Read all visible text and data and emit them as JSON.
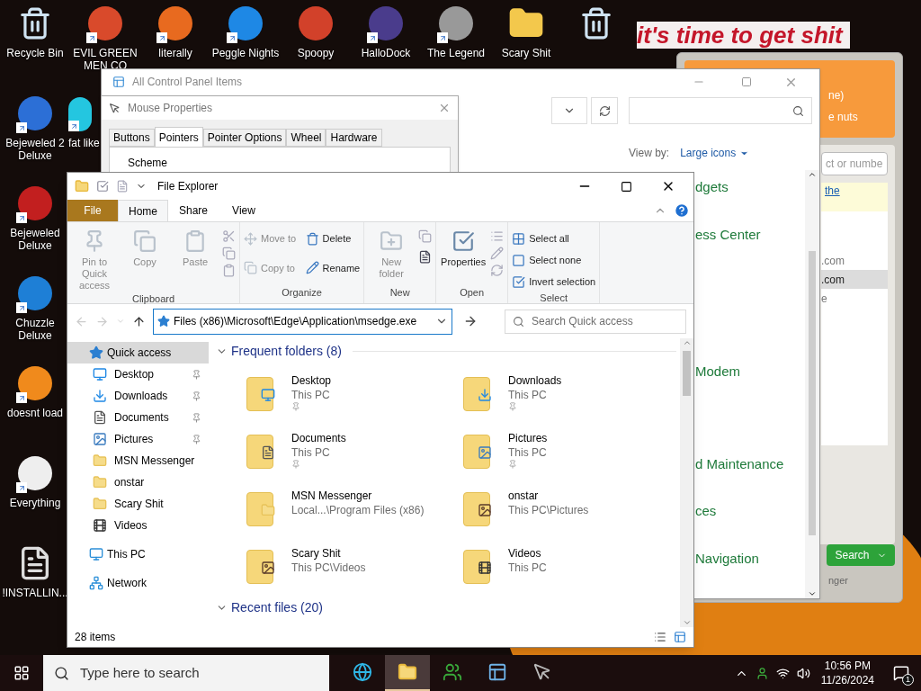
{
  "wallpaper": {
    "slogan": "it's time to get shit"
  },
  "desktop_top": [
    {
      "label": "Recycle Bin",
      "kind": "bin",
      "shortcut": false
    },
    {
      "label": "EVIL GREEN MEN CO",
      "kind": "app",
      "shortcut": true
    },
    {
      "label": "literally",
      "kind": "app",
      "shortcut": true
    },
    {
      "label": "Peggle Nights",
      "kind": "app",
      "shortcut": true
    },
    {
      "label": "Spoopy",
      "kind": "app",
      "shortcut": false
    },
    {
      "label": "HalloDock",
      "kind": "app",
      "shortcut": true
    },
    {
      "label": "The Legend",
      "kind": "app",
      "shortcut": true
    },
    {
      "label": "Scary Shit",
      "kind": "folder",
      "shortcut": false
    },
    {
      "kind": "bin",
      "shortcut": false
    }
  ],
  "desktop_left": [
    {
      "label": "Bejeweled 2 Deluxe",
      "kind": "app",
      "shortcut": true
    },
    {
      "label": "fat like",
      "kind": "app",
      "shortcut": true
    },
    {
      "label": "Bejeweled Deluxe",
      "kind": "app",
      "shortcut": true
    },
    {
      "label": "Chuzzle Deluxe",
      "kind": "app",
      "shortcut": true
    },
    {
      "label": "doesnt load",
      "kind": "app",
      "shortcut": true
    },
    {
      "label": "Everything",
      "kind": "app",
      "shortcut": true
    },
    {
      "label": "!INSTALLIN...",
      "kind": "document",
      "shortcut": false
    }
  ],
  "messenger": {
    "header_lines": [
      "ne)",
      "e nuts"
    ],
    "search_placeholder": "ct or numbe",
    "notice_link": "the",
    "contacts": [
      {
        "label": ".com",
        "selected": false
      },
      {
        "label": ".com",
        "selected": true
      },
      {
        "label": "e",
        "selected": false
      }
    ],
    "search_button": "Search",
    "footer": "nger"
  },
  "control_panel": {
    "title": "All Control Panel Items",
    "view_by_label": "View by:",
    "view_by_value": "Large icons",
    "items": [
      "dgets",
      "ess Center",
      "Modem",
      "d Maintenance",
      "ces",
      "Navigation"
    ]
  },
  "mouse_properties": {
    "title": "Mouse Properties",
    "tabs": [
      {
        "label": "Buttons",
        "selected": false
      },
      {
        "label": "Pointers",
        "selected": true
      },
      {
        "label": "Pointer Options",
        "selected": false
      },
      {
        "label": "Wheel",
        "selected": false
      },
      {
        "label": "Hardware",
        "selected": false
      }
    ],
    "group_label": "Scheme"
  },
  "file_explorer": {
    "title": "File Explorer",
    "ribbon_tabs": [
      {
        "label": "File",
        "selected": false,
        "kind": "file"
      },
      {
        "label": "Home",
        "selected": true,
        "kind": "tab"
      },
      {
        "label": "Share",
        "selected": false,
        "kind": "tab"
      },
      {
        "label": "View",
        "selected": false,
        "kind": "tab"
      }
    ],
    "ribbon_groups": [
      {
        "label": "Clipboard",
        "buttons": [
          {
            "label": "Pin to Quick access",
            "kind": "large",
            "disabled": true
          },
          {
            "label": "Copy",
            "kind": "large",
            "disabled": true
          },
          {
            "label": "Paste",
            "kind": "large",
            "disabled": true
          }
        ]
      },
      {
        "label": "Organize",
        "buttons": [
          {
            "label": "Move to",
            "kind": "small",
            "disabled": true
          },
          {
            "label": "Delete",
            "kind": "small",
            "disabled": false
          },
          {
            "label": "Copy to",
            "kind": "small",
            "disabled": true
          },
          {
            "label": "Rename",
            "kind": "small",
            "disabled": false
          }
        ]
      },
      {
        "label": "New",
        "buttons": [
          {
            "label": "New folder",
            "kind": "large",
            "disabled": true
          }
        ]
      },
      {
        "label": "Open",
        "buttons": [
          {
            "label": "Properties",
            "kind": "large",
            "disabled": false
          }
        ]
      },
      {
        "label": "Select",
        "buttons": [
          {
            "label": "Select all",
            "kind": "small",
            "disabled": false
          },
          {
            "label": "Select none",
            "kind": "small",
            "disabled": false
          },
          {
            "label": "Invert selection",
            "kind": "small",
            "disabled": false
          }
        ]
      }
    ],
    "address": "Files (x86)\\Microsoft\\Edge\\Application\\msedge.exe",
    "search_placeholder": "Search Quick access",
    "nav": [
      {
        "label": "Quick access",
        "selected": true,
        "kind": "star",
        "children": [
          {
            "label": "Desktop",
            "pinned": true,
            "kind": "desktop",
            "selected": false
          },
          {
            "label": "Downloads",
            "pinned": true,
            "kind": "download",
            "selected": false
          },
          {
            "label": "Documents",
            "pinned": true,
            "kind": "document",
            "selected": false
          },
          {
            "label": "Pictures",
            "pinned": true,
            "kind": "picture",
            "selected": false
          },
          {
            "label": "MSN Messenger",
            "pinned": false,
            "kind": "folder",
            "selected": false
          },
          {
            "label": "onstar",
            "pinned": false,
            "kind": "folder",
            "selected": false
          },
          {
            "label": "Scary Shit",
            "pinned": false,
            "kind": "folder",
            "selected": false
          },
          {
            "label": "Videos",
            "pinned": false,
            "kind": "video",
            "selected": false
          }
        ]
      },
      {
        "label": "This PC",
        "selected": false,
        "kind": "pc"
      },
      {
        "label": "Network",
        "selected": false,
        "kind": "network"
      }
    ],
    "section": "Frequent folders (8)",
    "folders": [
      {
        "name": "Desktop",
        "location": "This PC",
        "pinned": true,
        "kind": "desktop"
      },
      {
        "name": "Downloads",
        "location": "This PC",
        "pinned": true,
        "kind": "download"
      },
      {
        "name": "Documents",
        "location": "This PC",
        "pinned": true,
        "kind": "document"
      },
      {
        "name": "Pictures",
        "location": "This PC",
        "pinned": true,
        "kind": "picture"
      },
      {
        "name": "MSN Messenger",
        "location": "Local...\\Program Files (x86)",
        "pinned": false,
        "kind": "folder"
      },
      {
        "name": "onstar",
        "location": "This PC\\Pictures",
        "pinned": false,
        "kind": "photo"
      },
      {
        "name": "Scary Shit",
        "location": "This PC\\Videos",
        "pinned": false,
        "kind": "photo"
      },
      {
        "name": "Videos",
        "location": "This PC",
        "pinned": false,
        "kind": "video"
      }
    ],
    "next_section": "Recent files (20)",
    "status": "28 items"
  },
  "taskbar": {
    "search_placeholder": "Type here to search",
    "apps": [
      {
        "kind": "browser",
        "active": false
      },
      {
        "kind": "explorer",
        "active": true
      },
      {
        "kind": "messenger",
        "active": false
      },
      {
        "kind": "panel",
        "active": false
      },
      {
        "kind": "mouse",
        "active": false
      }
    ],
    "time": "10:56 PM",
    "date": "11/26/2024",
    "notifications": "1"
  }
}
